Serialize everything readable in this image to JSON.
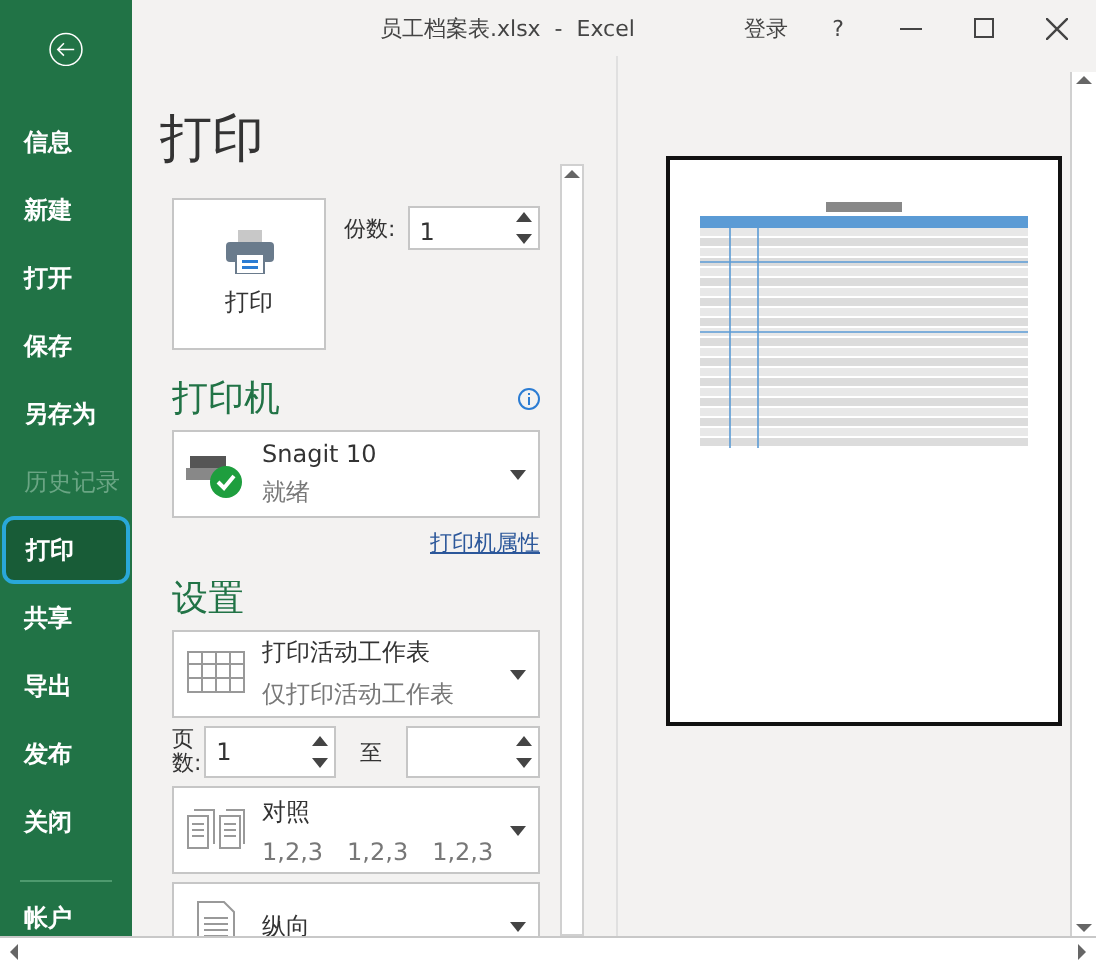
{
  "window": {
    "title": "员工档案表.xlsx  -  Excel",
    "sign_in": "登录",
    "help": "?"
  },
  "sidebar": {
    "items": [
      {
        "label": "信息",
        "selected": false,
        "disabled": false
      },
      {
        "label": "新建",
        "selected": false,
        "disabled": false
      },
      {
        "label": "打开",
        "selected": false,
        "disabled": false
      },
      {
        "label": "保存",
        "selected": false,
        "disabled": false
      },
      {
        "label": "另存为",
        "selected": false,
        "disabled": false
      },
      {
        "label": "历史记录",
        "selected": false,
        "disabled": true
      },
      {
        "label": "打印",
        "selected": true,
        "disabled": false
      },
      {
        "label": "共享",
        "selected": false,
        "disabled": false
      },
      {
        "label": "导出",
        "selected": false,
        "disabled": false
      },
      {
        "label": "发布",
        "selected": false,
        "disabled": false
      },
      {
        "label": "关闭",
        "selected": false,
        "disabled": false
      }
    ],
    "account": "帐户"
  },
  "heading": "打印",
  "print_button": "打印",
  "copies": {
    "label": "份数:",
    "value": "1"
  },
  "printer": {
    "heading": "打印机",
    "name": "Snagit 10",
    "status": "就绪",
    "properties_link": "打印机属性"
  },
  "settings": {
    "heading": "设置",
    "scope": {
      "title": "打印活动工作表",
      "subtitle": "仅打印活动工作表"
    },
    "pages": {
      "label": "页数:",
      "from": "1",
      "to_label": "至"
    },
    "collation": {
      "title": "对照",
      "orders": [
        "1,2,3",
        "1,2,3",
        "1,2,3"
      ]
    },
    "orientation": {
      "title": "纵向"
    }
  }
}
